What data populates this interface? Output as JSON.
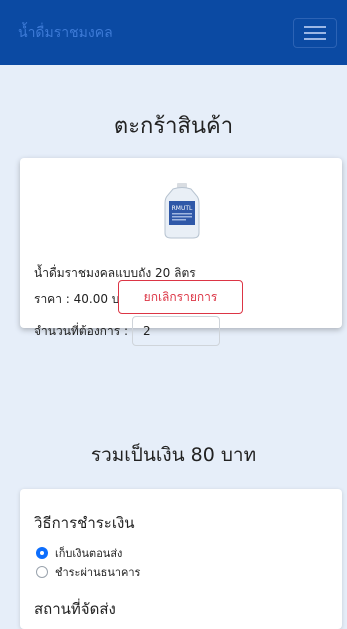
{
  "navbar": {
    "brand": "น้ำดื่มราชมงคล"
  },
  "page": {
    "title": "ตะกร้าสินค้า"
  },
  "cart": {
    "product_name": "น้ำดื่มราชมงคลแบบถัง 20 ลิตร",
    "price_text": "ราคา : 40.00 บาท",
    "qty_label": "จำนวนที่ต้องการ :",
    "qty_value": "2",
    "cancel_label": "ยกเลิกรายการ",
    "product_logo_text": "RMUTL"
  },
  "total": {
    "text": "รวมเป็นเงิน 80 บาท"
  },
  "payment": {
    "title": "วิธีการชำระเงิน",
    "options": [
      {
        "label": "เก็บเงินตอนส่ง",
        "selected": true
      },
      {
        "label": "ชำระผ่านธนาคาร",
        "selected": false
      }
    ],
    "shipping_title": "สถานที่จัดส่ง"
  },
  "colors": {
    "navbar": "#0b4aa3",
    "background": "#e6eef9",
    "danger": "#dc3545",
    "primary": "#0d6efd"
  }
}
